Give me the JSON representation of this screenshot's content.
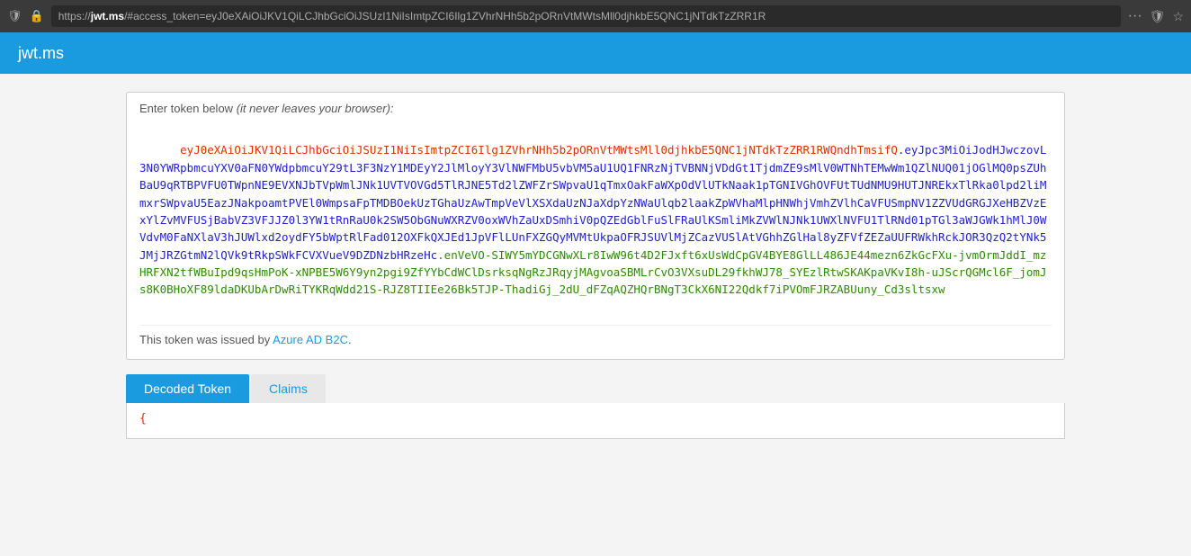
{
  "browser": {
    "url_prefix": "https://",
    "url_domain": "jwt.ms",
    "url_path": "/#access_token=eyJ0eXAiOiJKV1QiLCJhbGciOiJSUzI1NiIsImtpZCI6Ilg1ZVhrNHh5b2pORnVtMWtsMll0djhkbE5QNC1jNTdkTzZRR1R",
    "url_suffix": "...",
    "menu_dots": "···"
  },
  "navbar": {
    "site_title": "jwt.ms"
  },
  "token_box": {
    "hint_text": "Enter token below",
    "hint_italic": " (it never leaves your browser):",
    "token_header": "eyJ0eXAiOiJKV1QiLCJhbGciOiJSUzI1NiIsImtpZCI6Ilg1ZVhrNHh5b2pORnVtMWtsMll0djhkbE5QNC1jNTdkTzZRR1RWQndhTmsifQ",
    "token_payload": ".eyJpc3MiOiJodHJwczovL3N0YWRpbmcuYXV0aFN0YWdpbmcuY29tL3F3NzY1MDEyY2JlMloyY3VlNWFMbU5vbVM5aU1UQ1FNRzNjTVBNNjVDdGt1TjdmZE9sMlV0WTNhTEMwWm1QZlNUQ01jOGlMQ0psZUhBaU9qRTBPVFU0TWpnNE9EVXNJbTVpWmlJNk1UVTVOVGd5TlRJNE5Td2lZWFZrSWpvaU1qTmxOakFaWXpOdVlUTkNaak1pTGNIVGhOVFUtTUdNMU9HUTJNREkxTlRka0lpd2liMmxrSWpvaU5EazJNakpoamtPVEl0WmpsaFpTMDBOekUzTGhaUzAwTmpVeVlXSXdaUzNJaXdpYzNWaUlqb2laakZpWVhaMlpHNWhjVmhZVlhCaVFUSmpNV1ZZVUdGRGJXeHBZVzExYlZvMVFUSjBabVZ3VFJJZ0l3YW1tRnRaU0k2SW5ObGNuWXRZV0oxWVhZaUxDSmhiV0pQZEdGblFuSlFRaUlKSmliMkZVWlNJNk1UWXlNVFU1TlRNd01pTGl3aWJGWk1hMlJ0WVdvM0FaNXlaV3hJUWlxd2oydFY5bWptRlFad012OXFkQXJEd1JpVFlLUnFXZGQyMVMtUkpaOFRJSUVlMjZCazVUSlAtVGhhZGlHal8yZFVfZEZaUUFRWkhRckJOR3QzQ2tYNk5JMjJRZGtmN2lQVk9tRkpSWkFCVXVueV9DZDNzbHRzeHc",
    "token_signature": ".enVeVO-SIWY5mYDCGNwXLr8IwW96t4D2FJxft6xUsWdCpGV4BYE8GlLL486JE44mezn6ZkGcFXu-jvmOrmJddI_mzHRFXN2tfWBuIpd9qsHmPoK-xNPBE5W6Y9yn2pgi9ZfYYbCdWClDsrksqNgRzJRqyjMAgvoaSBMLrCvO3VXsuDL29fkhWJ78_SYEzlRtwSKAKpaVKvI8h-uJScrQGMcl6F_jomJs8K0BHoXF89ldaDKUbArDwRiTYKRqWdd21S-RJZ8TIIEe26Bk5TJP-ThadiGj_2dU_dFZqAQZHQrBNgT3CkX6NI22Qdkf7iPVOmFJRZABUuny_Cd3sltsxw",
    "issuer_text": "This token was issued by",
    "issuer_link_text": "Azure AD B2C",
    "issuer_link_url": "#"
  },
  "tabs": {
    "decoded_label": "Decoded Token",
    "claims_label": "Claims"
  },
  "decoded_output": {
    "opening_brace": "{"
  }
}
